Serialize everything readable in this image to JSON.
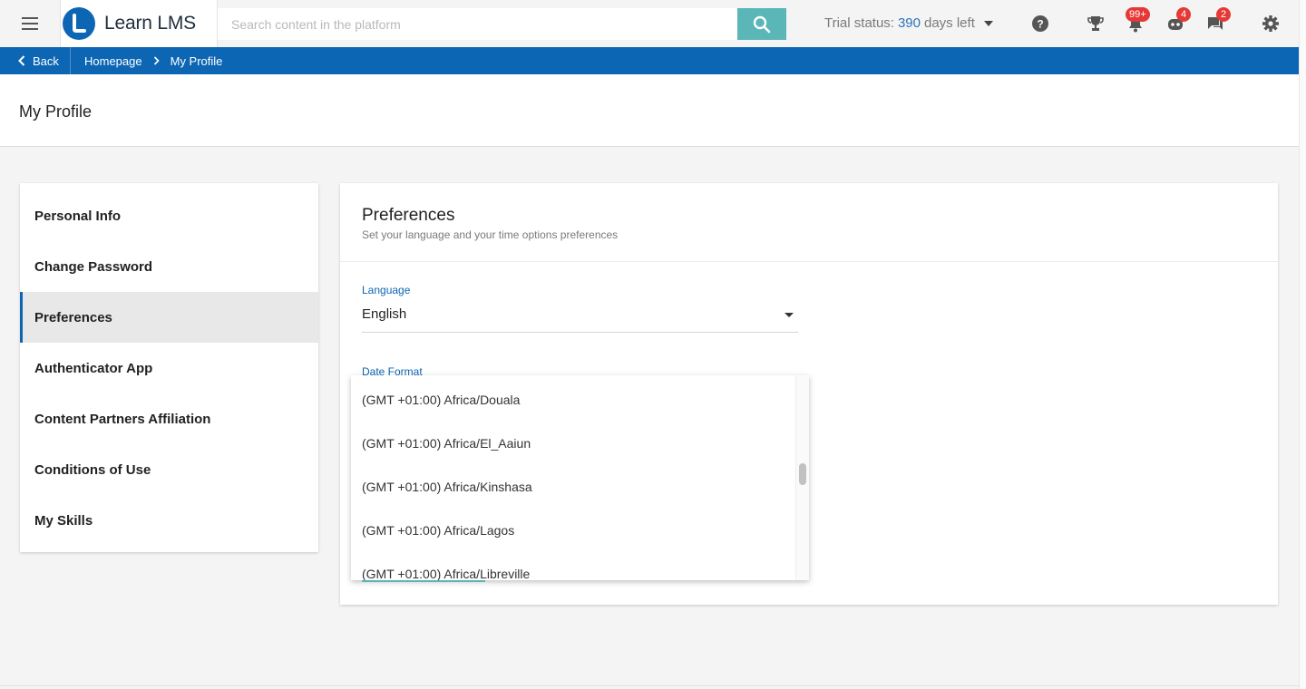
{
  "app": {
    "name": "Learn LMS"
  },
  "search": {
    "placeholder": "Search content in the platform"
  },
  "trial": {
    "prefix": "Trial status:",
    "days": "390",
    "suffix": "days left"
  },
  "notifications": [
    {
      "icon": "help-icon",
      "badge": ""
    },
    {
      "icon": "trophy-icon",
      "badge": ""
    },
    {
      "icon": "bell-icon",
      "badge": "99+"
    },
    {
      "icon": "robot-icon",
      "badge": "4"
    },
    {
      "icon": "chat-icon",
      "badge": "2"
    },
    {
      "icon": "gear-icon",
      "badge": ""
    }
  ],
  "breadcrumb": {
    "back": "Back",
    "home": "Homepage",
    "current": "My Profile"
  },
  "page": {
    "title": "My Profile"
  },
  "menu": {
    "items": [
      {
        "label": "Personal Info"
      },
      {
        "label": "Change Password"
      },
      {
        "label": "Preferences",
        "active": true
      },
      {
        "label": "Authenticator App"
      },
      {
        "label": "Content Partners Affiliation"
      },
      {
        "label": "Conditions of Use"
      },
      {
        "label": "My Skills"
      }
    ]
  },
  "preferences": {
    "title": "Preferences",
    "subtitle": "Set your language and your time options preferences",
    "language_label": "Language",
    "language_value": "English",
    "date_format_label": "Date Format"
  },
  "timezone_dropdown": {
    "options": [
      "(GMT +01:00) Africa/Douala",
      "(GMT +01:00) Africa/El_Aaiun",
      "(GMT +01:00) Africa/Kinshasa",
      "(GMT +01:00) Africa/Lagos",
      "(GMT +01:00) Africa/Libreville"
    ]
  },
  "colors": {
    "brand": "#0d66b3",
    "search_button": "#5bb6b7",
    "badge": "#e53935"
  }
}
